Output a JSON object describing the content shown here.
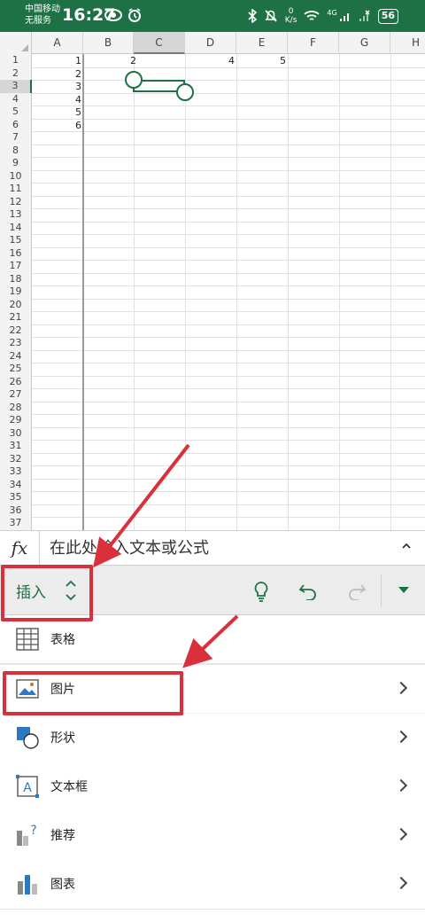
{
  "status_bar": {
    "carrier": "中国移动",
    "service": "无服务",
    "time": "16:27",
    "network_speed_value": "0",
    "network_speed_unit": "K/s",
    "network_type": "4G",
    "battery": "56"
  },
  "sheet": {
    "columns": [
      "A",
      "B",
      "C",
      "D",
      "E",
      "F",
      "G",
      "H"
    ],
    "selected_column": "C",
    "rows": [
      "1",
      "2",
      "3",
      "4",
      "5",
      "6",
      "7",
      "8",
      "9",
      "10",
      "11",
      "12",
      "13",
      "14",
      "15",
      "16",
      "17",
      "18",
      "19",
      "20",
      "21",
      "22",
      "23",
      "24",
      "25",
      "26",
      "27",
      "28",
      "29",
      "30",
      "31",
      "32",
      "33",
      "34",
      "35",
      "36",
      "37"
    ],
    "selected_row": "3",
    "cells": {
      "A1": "1",
      "A2": "2",
      "A3": "3",
      "A4": "4",
      "A5": "5",
      "A6": "6",
      "C1": "2",
      "D1": "4",
      "E1": "5"
    }
  },
  "formula_bar": {
    "fx_label": "fx",
    "placeholder": "在此处输入文本或公式"
  },
  "ribbon": {
    "tab_label": "插入"
  },
  "menu": {
    "items": [
      {
        "label": "表格",
        "icon": "table-icon",
        "has_chevron": false
      },
      {
        "label": "图片",
        "icon": "picture-icon",
        "has_chevron": true
      },
      {
        "label": "形状",
        "icon": "shapes-icon",
        "has_chevron": true
      },
      {
        "label": "文本框",
        "icon": "textbox-icon",
        "has_chevron": true
      },
      {
        "label": "推荐",
        "icon": "recommended-chart-icon",
        "has_chevron": true
      },
      {
        "label": "图表",
        "icon": "chart-icon",
        "has_chevron": true
      }
    ]
  },
  "colors": {
    "accent": "#1e7145",
    "annotation": "#d9303b"
  }
}
